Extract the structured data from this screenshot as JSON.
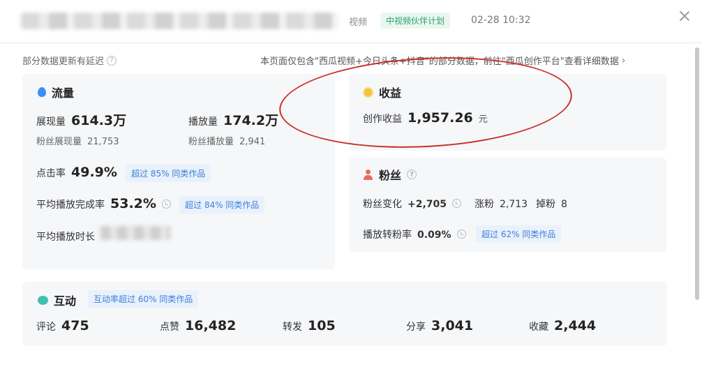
{
  "header": {
    "video_tag": "视频",
    "plan_tag": "中视频伙伴计划",
    "date": "02-28 10:32"
  },
  "notice": {
    "left": "部分数据更新有延迟",
    "right": "本页面仅包含\"西瓜视频+今日头条+抖音\"的部分数据，前往\"西瓜创作平台\"查看详细数据"
  },
  "traffic": {
    "title": "流量",
    "impressions_label": "展现量",
    "impressions_value": "614.3万",
    "plays_label": "播放量",
    "plays_value": "174.2万",
    "fan_impressions_label": "粉丝展现量",
    "fan_impressions_value": "21,753",
    "fan_plays_label": "粉丝播放量",
    "fan_plays_value": "2,941",
    "ctr_label": "点击率",
    "ctr_value": "49.9%",
    "ctr_badge": "超过 85% 同类作品",
    "completion_label": "平均播放完成率",
    "completion_value": "53.2%",
    "completion_badge": "超过 84% 同类作品",
    "duration_label": "平均播放时长"
  },
  "income": {
    "title": "收益",
    "label": "创作收益",
    "value": "1,957.26",
    "unit": "元"
  },
  "fans": {
    "title": "粉丝",
    "change_label": "粉丝变化",
    "change_value": "+2,705",
    "gain_label": "涨粉",
    "gain_value": "2,713",
    "loss_label": "掉粉",
    "loss_value": "8",
    "conv_label": "播放转粉率",
    "conv_value": "0.09%",
    "conv_badge": "超过 62% 同类作品"
  },
  "interaction": {
    "title": "互动",
    "badge": "互动率超过 60% 同类作品",
    "items": [
      {
        "label": "评论",
        "value": "475"
      },
      {
        "label": "点赞",
        "value": "16,482"
      },
      {
        "label": "转发",
        "value": "105"
      },
      {
        "label": "分享",
        "value": "3,041"
      },
      {
        "label": "收藏",
        "value": "2,444"
      }
    ]
  }
}
